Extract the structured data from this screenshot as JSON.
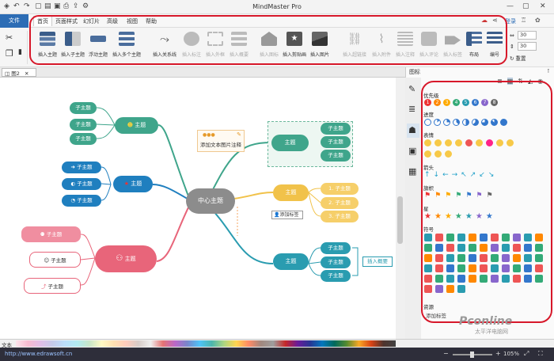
{
  "app": {
    "title": "MindMaster Pro",
    "login": "登录"
  },
  "menu": {
    "file": "文件",
    "tabs": [
      "首页",
      "页面样式",
      "幻灯片",
      "高级",
      "视图",
      "帮助"
    ],
    "active_tab": "首页"
  },
  "ribbon": {
    "buttons": [
      {
        "label": "插入主题",
        "enabled": true
      },
      {
        "label": "插入子主题",
        "enabled": true
      },
      {
        "label": "浮动主题",
        "enabled": true
      },
      {
        "label": "插入多个主题",
        "enabled": true
      },
      {
        "label": "插入关系线",
        "enabled": true
      },
      {
        "label": "插入标注",
        "enabled": false
      },
      {
        "label": "插入外框",
        "enabled": false
      },
      {
        "label": "插入概要",
        "enabled": false
      },
      {
        "label": "插入图标",
        "enabled": false
      },
      {
        "label": "插入剪贴画",
        "enabled": true
      },
      {
        "label": "插入图片",
        "enabled": true
      },
      {
        "label": "插入超链接",
        "enabled": false
      },
      {
        "label": "插入附件",
        "enabled": false
      },
      {
        "label": "插入注释",
        "enabled": false
      },
      {
        "label": "插入评论",
        "enabled": false
      },
      {
        "label": "插入标签",
        "enabled": false
      },
      {
        "label": "布局",
        "enabled": true
      },
      {
        "label": "编号",
        "enabled": true
      }
    ],
    "spin1": "30",
    "spin2": "30",
    "reset": "重置"
  },
  "doc_tab": "图2",
  "mindmap": {
    "center": "中心主题",
    "note": "添加文本图片注释",
    "topic": "主题",
    "subtopic": "子主题",
    "numbered": [
      "1. 子主题",
      "2. 子主题",
      "3. 子主题"
    ],
    "add_tag": "添加标签",
    "insert_summary": "插入概要"
  },
  "panel": {
    "title": "图标",
    "sections": [
      "优先级",
      "进度",
      "表情",
      "箭头",
      "旗帜",
      "星",
      "符号",
      "资源"
    ],
    "priority": [
      "1",
      "2",
      "3",
      "4",
      "5",
      "6",
      "7",
      "8"
    ],
    "add_tag": "添加标签"
  },
  "statusbar": {
    "text_label": "文本",
    "url": "http://www.edrawsoft.cn",
    "zoom": "105%"
  },
  "watermark": {
    "brand": "Pconline",
    "sub": "太平洋电脑网"
  }
}
